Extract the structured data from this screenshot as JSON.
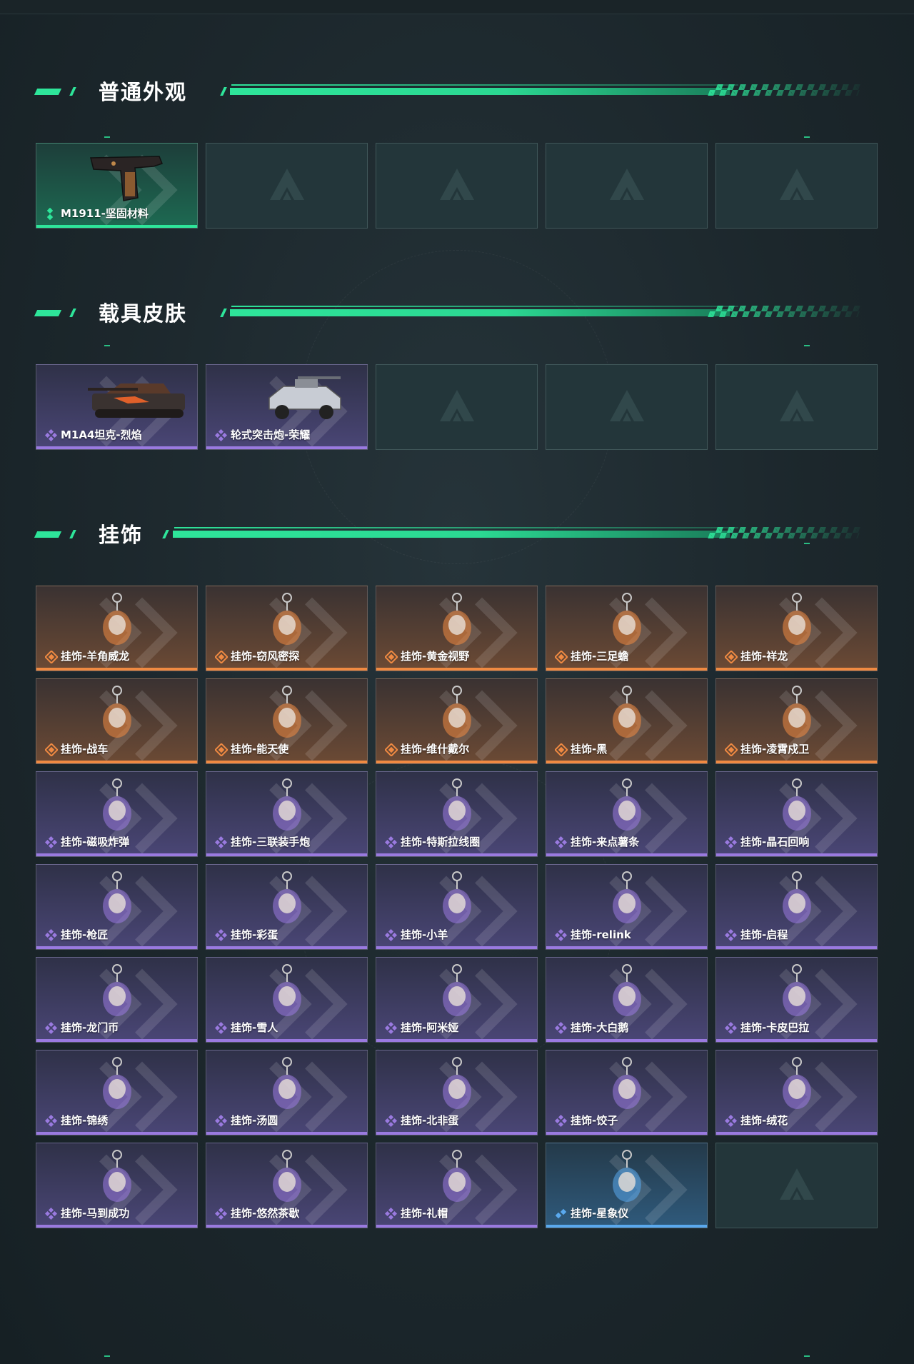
{
  "sections": {
    "normal": {
      "title": "普通外观",
      "items": [
        {
          "label": "M1911-坚固材料",
          "rarity": "green",
          "icon": "pistol-icon"
        },
        {
          "label": "",
          "rarity": "empty"
        },
        {
          "label": "",
          "rarity": "empty"
        },
        {
          "label": "",
          "rarity": "empty"
        },
        {
          "label": "",
          "rarity": "empty"
        }
      ]
    },
    "vehicle": {
      "title": "载具皮肤",
      "items": [
        {
          "label": "M1A4坦克-烈焰",
          "rarity": "purple",
          "icon": "tank-icon"
        },
        {
          "label": "轮式突击炮-荣耀",
          "rarity": "purple",
          "icon": "armored-car-icon"
        },
        {
          "label": "",
          "rarity": "empty"
        },
        {
          "label": "",
          "rarity": "empty"
        },
        {
          "label": "",
          "rarity": "empty"
        }
      ]
    },
    "charms": {
      "title": "挂饰",
      "items": [
        {
          "label": "挂饰-羊角威龙",
          "rarity": "orange",
          "icon": "charm-icon"
        },
        {
          "label": "挂饰-窃风密探",
          "rarity": "orange",
          "icon": "charm-icon"
        },
        {
          "label": "挂饰-黄金视野",
          "rarity": "orange",
          "icon": "charm-icon"
        },
        {
          "label": "挂饰-三足蟾",
          "rarity": "orange",
          "icon": "charm-icon"
        },
        {
          "label": "挂饰-祥龙",
          "rarity": "orange",
          "icon": "charm-icon"
        },
        {
          "label": "挂饰-战车",
          "rarity": "orange",
          "icon": "charm-icon"
        },
        {
          "label": "挂饰-能天使",
          "rarity": "orange",
          "icon": "charm-icon"
        },
        {
          "label": "挂饰-维什戴尔",
          "rarity": "orange",
          "icon": "charm-icon"
        },
        {
          "label": "挂饰-黑",
          "rarity": "orange",
          "icon": "charm-icon"
        },
        {
          "label": "挂饰-凌霄戍卫",
          "rarity": "orange",
          "icon": "charm-icon"
        },
        {
          "label": "挂饰-磁吸炸弹",
          "rarity": "purple",
          "icon": "charm-icon"
        },
        {
          "label": "挂饰-三联装手炮",
          "rarity": "purple",
          "icon": "charm-icon"
        },
        {
          "label": "挂饰-特斯拉线圈",
          "rarity": "purple",
          "icon": "charm-icon"
        },
        {
          "label": "挂饰-来点薯条",
          "rarity": "purple",
          "icon": "charm-icon"
        },
        {
          "label": "挂饰-晶石回响",
          "rarity": "purple",
          "icon": "charm-icon"
        },
        {
          "label": "挂饰-枪匠",
          "rarity": "purple",
          "icon": "charm-icon"
        },
        {
          "label": "挂饰-彩蛋",
          "rarity": "purple",
          "icon": "charm-icon"
        },
        {
          "label": "挂饰-小羊",
          "rarity": "purple",
          "icon": "charm-icon"
        },
        {
          "label": "挂饰-relink",
          "rarity": "purple",
          "icon": "charm-icon"
        },
        {
          "label": "挂饰-启程",
          "rarity": "purple",
          "icon": "charm-icon"
        },
        {
          "label": "挂饰-龙门币",
          "rarity": "purple",
          "icon": "charm-icon"
        },
        {
          "label": "挂饰-雪人",
          "rarity": "purple",
          "icon": "charm-icon"
        },
        {
          "label": "挂饰-阿米娅",
          "rarity": "purple",
          "icon": "charm-icon"
        },
        {
          "label": "挂饰-大白鹅",
          "rarity": "purple",
          "icon": "charm-icon"
        },
        {
          "label": "挂饰-卡皮巴拉",
          "rarity": "purple",
          "icon": "charm-icon"
        },
        {
          "label": "挂饰-锦绣",
          "rarity": "purple",
          "icon": "charm-icon"
        },
        {
          "label": "挂饰-汤圆",
          "rarity": "purple",
          "icon": "charm-icon"
        },
        {
          "label": "挂饰-北非蛋",
          "rarity": "purple",
          "icon": "charm-icon"
        },
        {
          "label": "挂饰-饺子",
          "rarity": "purple",
          "icon": "charm-icon"
        },
        {
          "label": "挂饰-绒花",
          "rarity": "purple",
          "icon": "charm-icon"
        },
        {
          "label": "挂饰-马到成功",
          "rarity": "purple",
          "icon": "charm-icon"
        },
        {
          "label": "挂饰-悠然茶歇",
          "rarity": "purple",
          "icon": "charm-icon"
        },
        {
          "label": "挂饰-礼帽",
          "rarity": "purple",
          "icon": "charm-icon"
        },
        {
          "label": "挂饰-星象仪",
          "rarity": "blue",
          "icon": "charm-icon"
        },
        {
          "label": "",
          "rarity": "empty"
        }
      ]
    }
  },
  "colors": {
    "accent": "#2ee59a",
    "green": "#2ee59a",
    "purple": "#9a7ae0",
    "orange": "#f08a42",
    "blue": "#5aa9ee"
  }
}
